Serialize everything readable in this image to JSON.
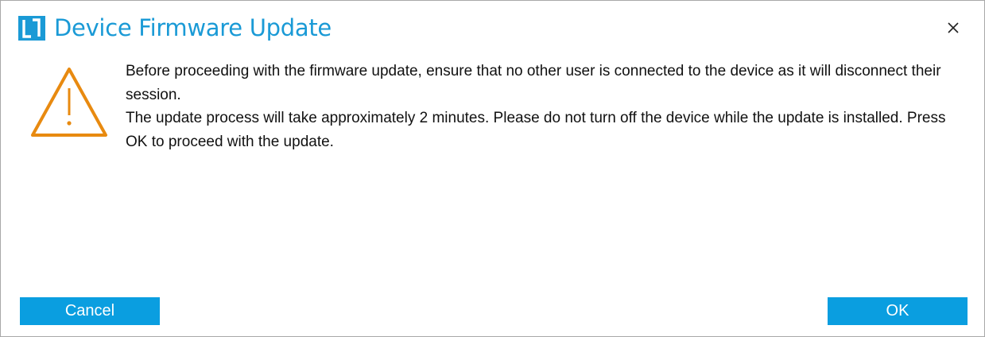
{
  "dialog": {
    "title": "Device Firmware Update",
    "logo_icon": "l1-logo-icon",
    "close_icon": "close-icon",
    "warning_icon": "warning-triangle-icon",
    "message": {
      "line1": "Before proceeding with the firmware update, ensure that no other user is connected to the device as it will disconnect their session.",
      "line2": "The update process will take approximately 2 minutes. Please do not turn off the device while the update is installed. Press OK to proceed with the update."
    },
    "buttons": {
      "cancel_label": "Cancel",
      "ok_label": "OK"
    }
  },
  "colors": {
    "accent": "#1a9ad6",
    "button": "#0a9ee0",
    "warning": "#e88a10"
  }
}
